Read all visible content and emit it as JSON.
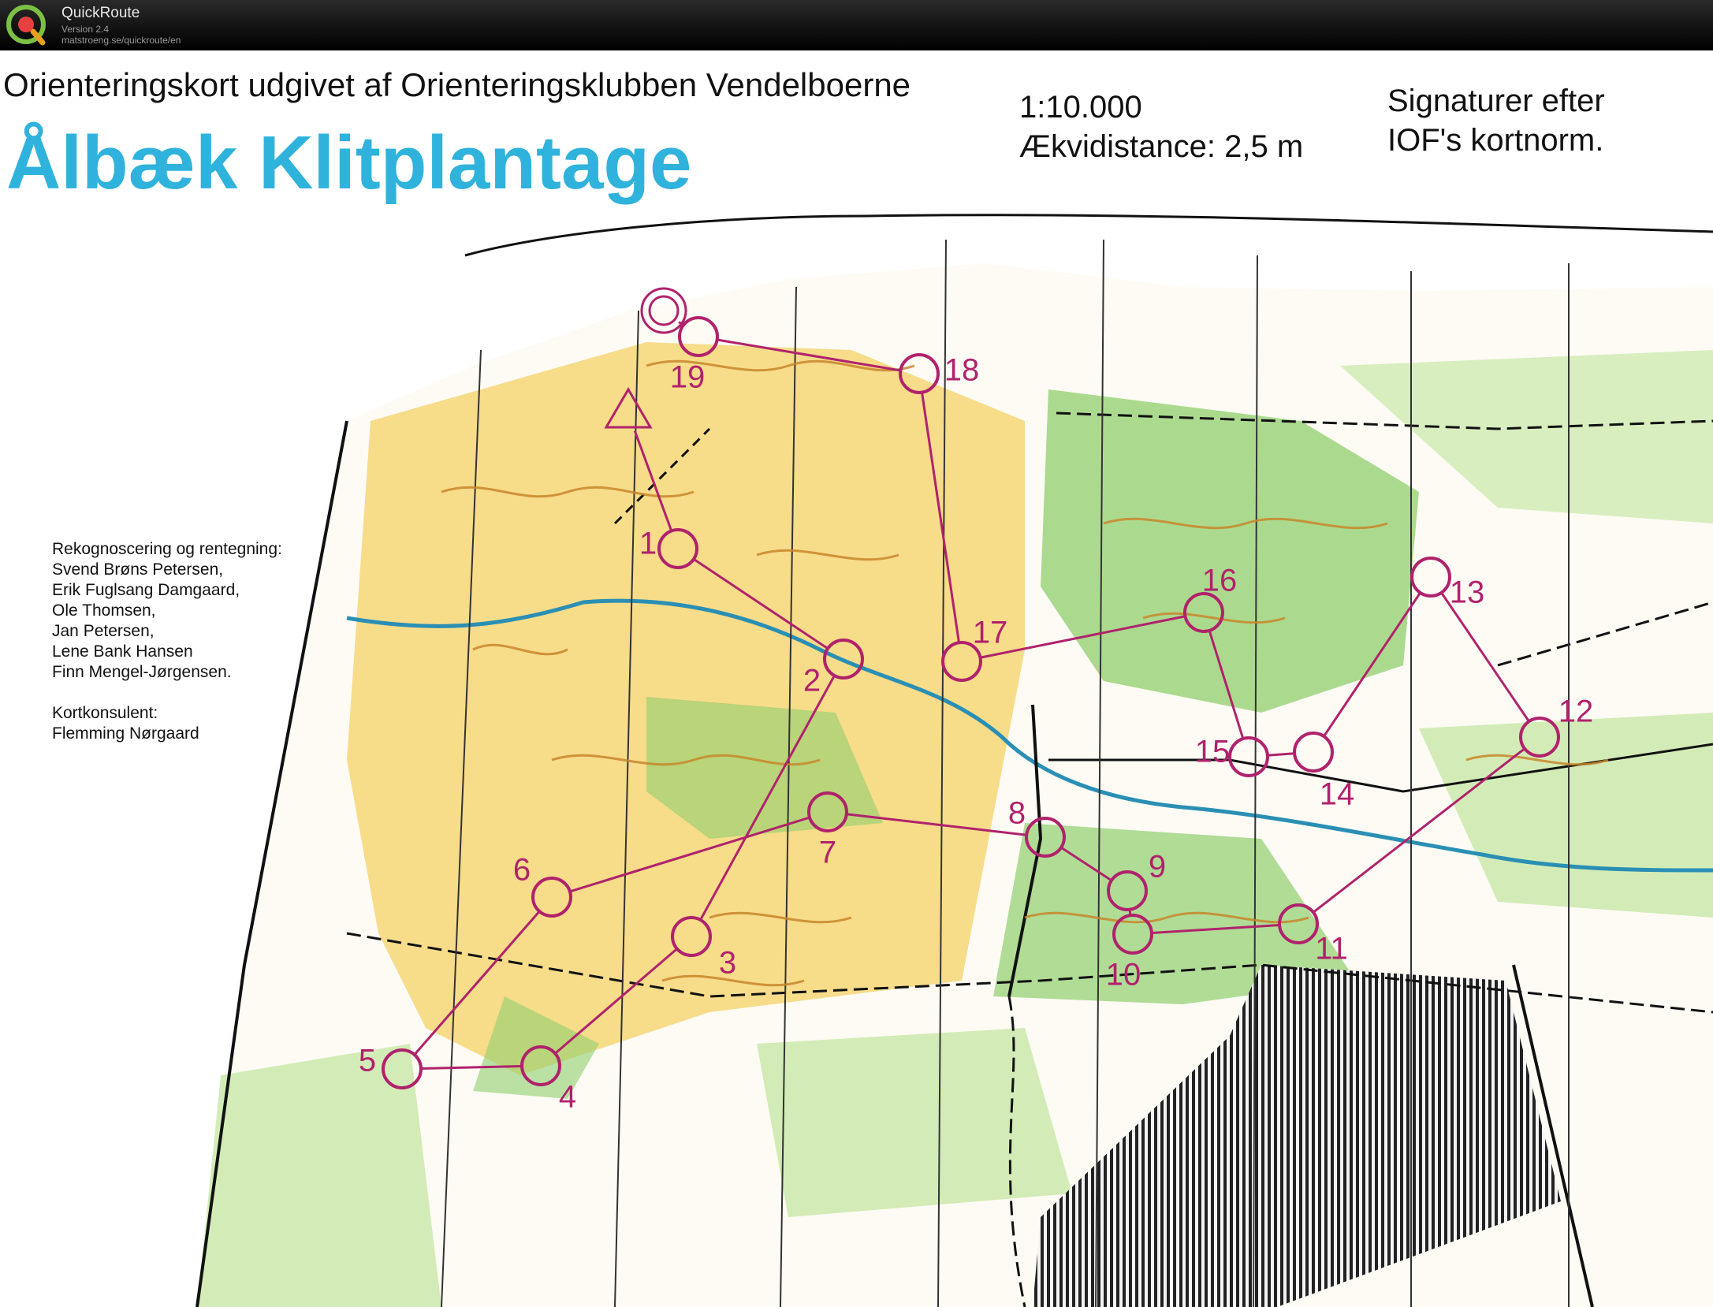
{
  "app": {
    "name": "QuickRoute",
    "version": "Version 2.4",
    "url": "matstroeng.se/quickroute/en"
  },
  "map": {
    "header": "Orienteringskort udgivet af Orienteringsklubben Vendelboerne",
    "title": "Ålbæk Klitplantage",
    "scale": "1:10.000",
    "contour_interval": "Ækvidistance: 2,5 m",
    "symbols_line1": "Signaturer efter",
    "symbols_line2": "IOF's kortnorm.",
    "credits": {
      "survey_heading": "Rekognoscering og rentegning:",
      "surveyors": [
        "Svend Brøns Petersen,",
        "Erik Fuglsang Damgaard,",
        "Ole Thomsen,",
        "Jan Petersen,",
        "Lene Bank Hansen",
        "Finn Mengel-Jørgensen."
      ],
      "consultant_heading": "Kortkonsulent:",
      "consultant": "Flemming Nørgaard"
    },
    "course": {
      "color": "#b0226c",
      "controls": [
        "1",
        "2",
        "3",
        "4",
        "5",
        "6",
        "7",
        "8",
        "9",
        "10",
        "11",
        "12",
        "13",
        "14",
        "15",
        "16",
        "17",
        "18",
        "19"
      ]
    },
    "colors": {
      "open_land": "#f7dc8a",
      "forest_green": "#8fcf6e",
      "light_green": "#c8e8a8",
      "contour": "#c8862a",
      "water": "#2a8fb4",
      "title_blue": "#2fb3dc"
    }
  }
}
